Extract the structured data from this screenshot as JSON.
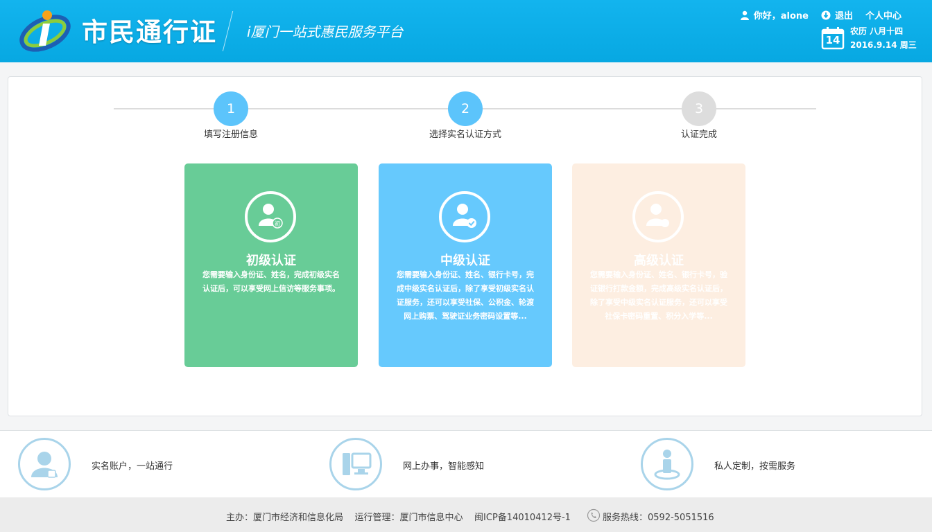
{
  "header": {
    "title": "市民通行证",
    "subtitle": "i厦门一站式惠民服务平台",
    "greeting": "你好，alone",
    "logout": "退出",
    "personal_center": "个人中心",
    "calendar_day": "14",
    "lunar_date": "农历  八月十四",
    "solar_date": "2016.9.14  周三",
    "colors": {
      "bar": "#0aaee8"
    }
  },
  "steps": [
    {
      "number": "1",
      "label": "填写注册信息",
      "state": "done"
    },
    {
      "number": "2",
      "label": "选择实名认证方式",
      "state": "current"
    },
    {
      "number": "3",
      "label": "认证完成",
      "state": "pending"
    }
  ],
  "cards": [
    {
      "title": "初级认证",
      "desc": "您需要输入身份证、姓名，完成初级实名认证后，可以享受网上信访等服务事项。",
      "badge": "初",
      "color": "#68cc97"
    },
    {
      "title": "中级认证",
      "desc": "您需要输入身份证、姓名、银行卡号，完成中级实名认证后，除了享受初级实名认证服务，还可以享受社保、公积金、轮渡网上购票、驾驶证业务密码设置等...",
      "badge": "check",
      "color": "#66c9fd"
    },
    {
      "title": "高级认证",
      "desc": "您需要输入身份证、姓名、银行卡号，验证银行打款金额，完成高级实名认证后，除了享受中级实名认证服务，还可以享受社保卡密码重置、积分入学等...",
      "badge": "plus",
      "color": "#fdeee1"
    }
  ],
  "features": [
    {
      "text": "实名账户，一站通行",
      "icon": "user-id-icon"
    },
    {
      "text": "网上办事，智能感知",
      "icon": "computer-icon"
    },
    {
      "text": "私人定制，按需服务",
      "icon": "person-location-icon"
    }
  ],
  "footer": {
    "info": "主办：厦门市经济和信息化局    运行管理：厦门市信息中心    闽ICP备14010412号-1",
    "hotline": "服务热线：0592-5051516"
  }
}
